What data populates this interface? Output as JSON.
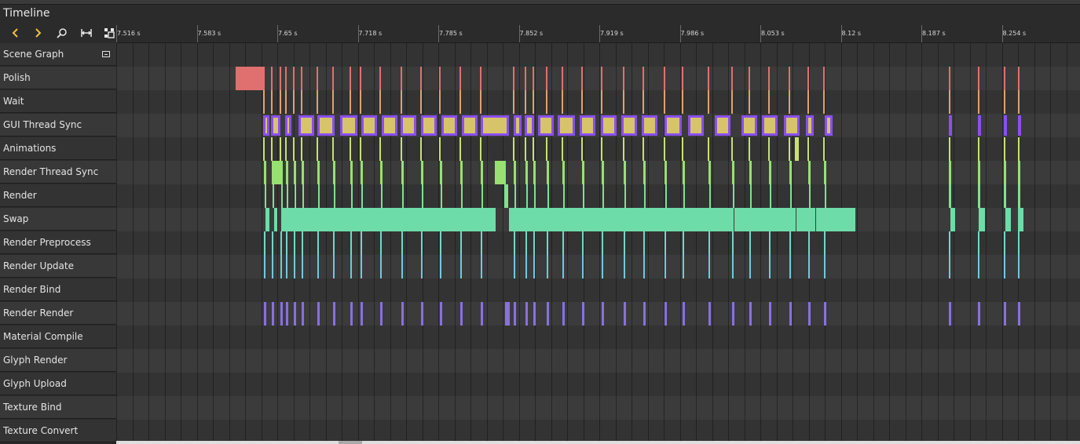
{
  "window": {
    "title": "Timeline"
  },
  "toolbar": [
    {
      "name": "back-icon",
      "glyph": "‹"
    },
    {
      "name": "forward-icon",
      "glyph": "›"
    },
    {
      "name": "zoom-icon",
      "glyph": "⚲"
    },
    {
      "name": "fit-range-icon",
      "glyph": "|↔|"
    },
    {
      "name": "select-range-icon",
      "glyph": "▦"
    }
  ],
  "ruler": {
    "ticks": [
      "7.516 s",
      "7.583 s",
      "7.65 s",
      "7.718 s",
      "7.785 s",
      "7.852 s",
      "7.919 s",
      "7.986 s",
      "8.053 s",
      "8.12 s",
      "8.187 s",
      "8.254 s"
    ]
  },
  "categories": [
    {
      "label": "Scene Graph"
    },
    {
      "label": "Polish"
    },
    {
      "label": "Wait"
    },
    {
      "label": "GUI Thread Sync"
    },
    {
      "label": "Animations"
    },
    {
      "label": "Render Thread Sync"
    },
    {
      "label": "Render"
    },
    {
      "label": "Swap"
    },
    {
      "label": "Render Preprocess"
    },
    {
      "label": "Render Update"
    },
    {
      "label": "Render Bind"
    },
    {
      "label": "Render Render"
    },
    {
      "label": "Material Compile"
    },
    {
      "label": "Glyph Render"
    },
    {
      "label": "Glyph Upload"
    },
    {
      "label": "Texture Bind"
    },
    {
      "label": "Texture Convert"
    }
  ],
  "colors": {
    "accent": "#f2c23a",
    "polish": "#e07070",
    "wait": "#e0a070",
    "gui_sync_border": "#8a4ff0",
    "gui_sync_fill": "#d7c46a",
    "animations": "#c8e070",
    "render_sync": "#98e070",
    "render": "#80e090",
    "swap": "#6edca8",
    "preprocess": "#70d8c8",
    "update": "#70c8e0",
    "render_render": "#8870e0"
  }
}
